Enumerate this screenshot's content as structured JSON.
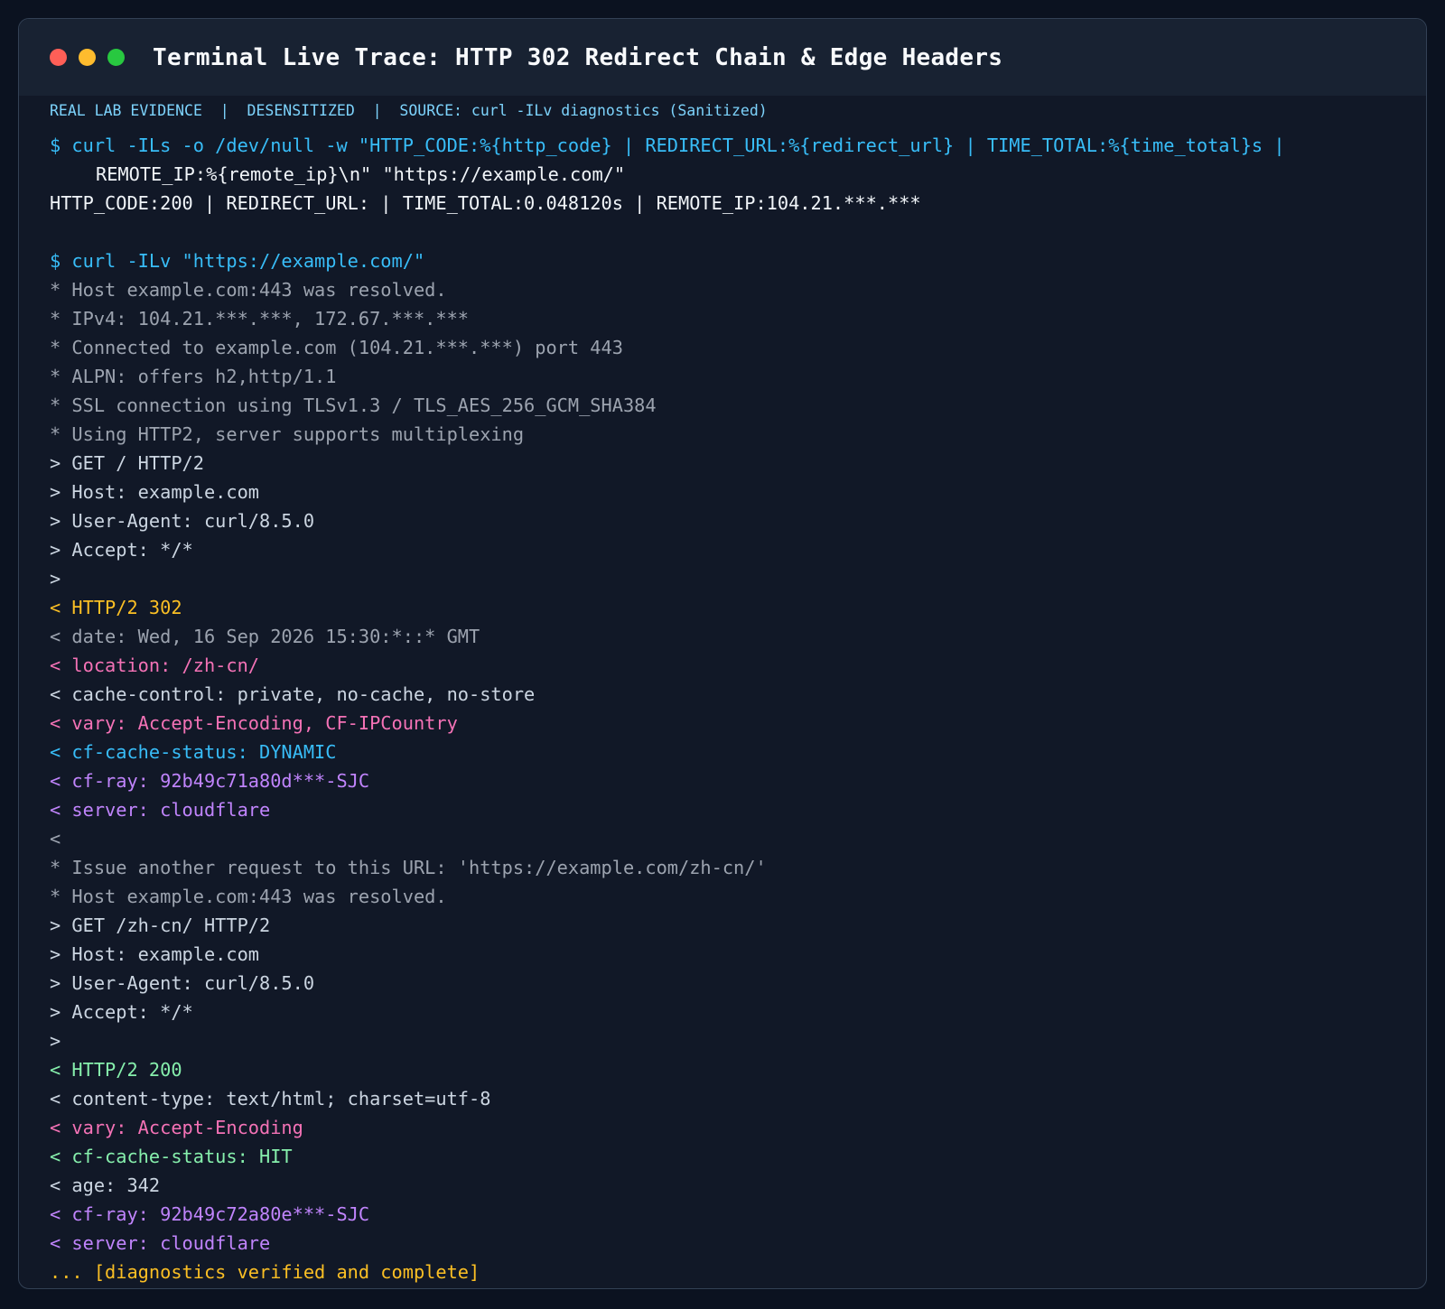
{
  "window": {
    "title": "Terminal Live Trace: HTTP 302 Redirect Chain & Edge Headers",
    "controls": {
      "close_color": "#ff5f57",
      "minimize_color": "#febc2e",
      "maximize_color": "#28c840"
    }
  },
  "evidence_label": "REAL LAB EVIDENCE  |  DESENSITIZED  |  SOURCE: curl -ILv diagnostics (Sanitized)",
  "terminal": {
    "lines": [
      {
        "text": "$ curl -ILs -o /dev/null -w \"HTTP_CODE:%{http_code} | REDIRECT_URL:%{redirect_url} | TIME_TOTAL:%{time_total}s |",
        "color": "cmd"
      },
      {
        "text": "REMOTE_IP:%{remote_ip}\\n\" \"https://example.com/\"",
        "color": "white",
        "indent": true
      },
      {
        "text": "HTTP_CODE:200 | REDIRECT_URL: | TIME_TOTAL:0.048120s | REMOTE_IP:104.21.***.***",
        "color": "white"
      },
      {
        "text": "",
        "color": "white"
      },
      {
        "text": "$ curl -ILv \"https://example.com/\"",
        "color": "cmd"
      },
      {
        "text": "* Host example.com:443 was resolved.",
        "color": "dim"
      },
      {
        "text": "* IPv4: 104.21.***.***, 172.67.***.***",
        "color": "dim"
      },
      {
        "text": "* Connected to example.com (104.21.***.***) port 443",
        "color": "dim"
      },
      {
        "text": "* ALPN: offers h2,http/1.1",
        "color": "dim"
      },
      {
        "text": "* SSL connection using TLSv1.3 / TLS_AES_256_GCM_SHA384",
        "color": "dim"
      },
      {
        "text": "* Using HTTP2, server supports multiplexing",
        "color": "dim"
      },
      {
        "text": "> GET / HTTP/2",
        "color": "gray"
      },
      {
        "text": "> Host: example.com",
        "color": "gray"
      },
      {
        "text": "> User-Agent: curl/8.5.0",
        "color": "gray"
      },
      {
        "text": "> Accept: */*",
        "color": "gray"
      },
      {
        "text": ">",
        "color": "gray"
      },
      {
        "text": "< HTTP/2 302",
        "color": "yellow"
      },
      {
        "text": "< date: Wed, 16 Sep 2026 15:30:*::* GMT",
        "color": "dim"
      },
      {
        "text": "< location: /zh-cn/",
        "color": "pink"
      },
      {
        "text": "< cache-control: private, no-cache, no-store",
        "color": "gray"
      },
      {
        "text": "< vary: Accept-Encoding, CF-IPCountry",
        "color": "pink"
      },
      {
        "text": "< cf-cache-status: DYNAMIC",
        "color": "blue"
      },
      {
        "text": "< cf-ray: 92b49c71a80d***-SJC",
        "color": "purple"
      },
      {
        "text": "< server: cloudflare",
        "color": "purple"
      },
      {
        "text": "<",
        "color": "dim"
      },
      {
        "text": "* Issue another request to this URL: 'https://example.com/zh-cn/'",
        "color": "dim"
      },
      {
        "text": "* Host example.com:443 was resolved.",
        "color": "dim"
      },
      {
        "text": "> GET /zh-cn/ HTTP/2",
        "color": "gray"
      },
      {
        "text": "> Host: example.com",
        "color": "gray"
      },
      {
        "text": "> User-Agent: curl/8.5.0",
        "color": "gray"
      },
      {
        "text": "> Accept: */*",
        "color": "gray"
      },
      {
        "text": ">",
        "color": "gray"
      },
      {
        "text": "< HTTP/2 200",
        "color": "green"
      },
      {
        "text": "< content-type: text/html; charset=utf-8",
        "color": "gray"
      },
      {
        "text": "< vary: Accept-Encoding",
        "color": "pink"
      },
      {
        "text": "< cf-cache-status: HIT",
        "color": "green"
      },
      {
        "text": "< age: 342",
        "color": "gray"
      },
      {
        "text": "< cf-ray: 92b49c72a80e***-SJC",
        "color": "purple"
      },
      {
        "text": "< server: cloudflare",
        "color": "purple"
      },
      {
        "text": "... [diagnostics verified and complete]",
        "color": "yellow"
      }
    ]
  }
}
